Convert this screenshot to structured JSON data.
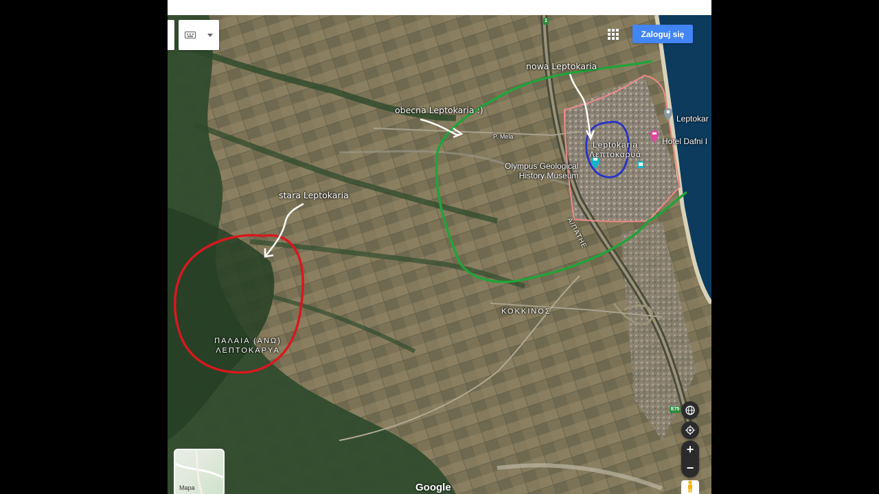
{
  "toolbar": {
    "login_label": "Zaloguj się",
    "keyboard_icon": "keyboard-icon",
    "dropdown_icon": "chevron-down-icon",
    "apps_icon": "apps-grid-icon"
  },
  "annotations": {
    "nowa": "nowa Leptokaria",
    "obecna": "obecna Leptokaria :)",
    "stara": "stara Leptokaria"
  },
  "places": {
    "old_town_line1": "ΠΑΛΑΙΑ (ΑΝΩ)",
    "old_town_line2": "ΛΕΠΤΟΚΑΡΥΑ",
    "kokkinos": "ΚΟΚΚΙΝΟΣ",
    "town_latin": "Leptokaria",
    "town_greek": "Λεπτοκαρυά",
    "highway_label": "Α/ΠΑΤΗΕ",
    "road_label": "P. Mela",
    "museum_line1": "Olympus Geological",
    "museum_line2": "History Museum",
    "leptokaria_pin": "Leptokar",
    "hotel": "Hotel Dafni I"
  },
  "road_shields": {
    "top": "1",
    "e75": "E75"
  },
  "controls": {
    "map_type_label": "Mapa",
    "zoom_in": "+",
    "zoom_out": "−",
    "google_logo": "Google"
  },
  "colors": {
    "red_circle": "#d6191f",
    "green_line": "#22a33a",
    "blue_circle": "#2a35c4",
    "town_boundary": "#f08a8a",
    "sea": "#0c3b5e",
    "login_button": "#4285f4"
  }
}
